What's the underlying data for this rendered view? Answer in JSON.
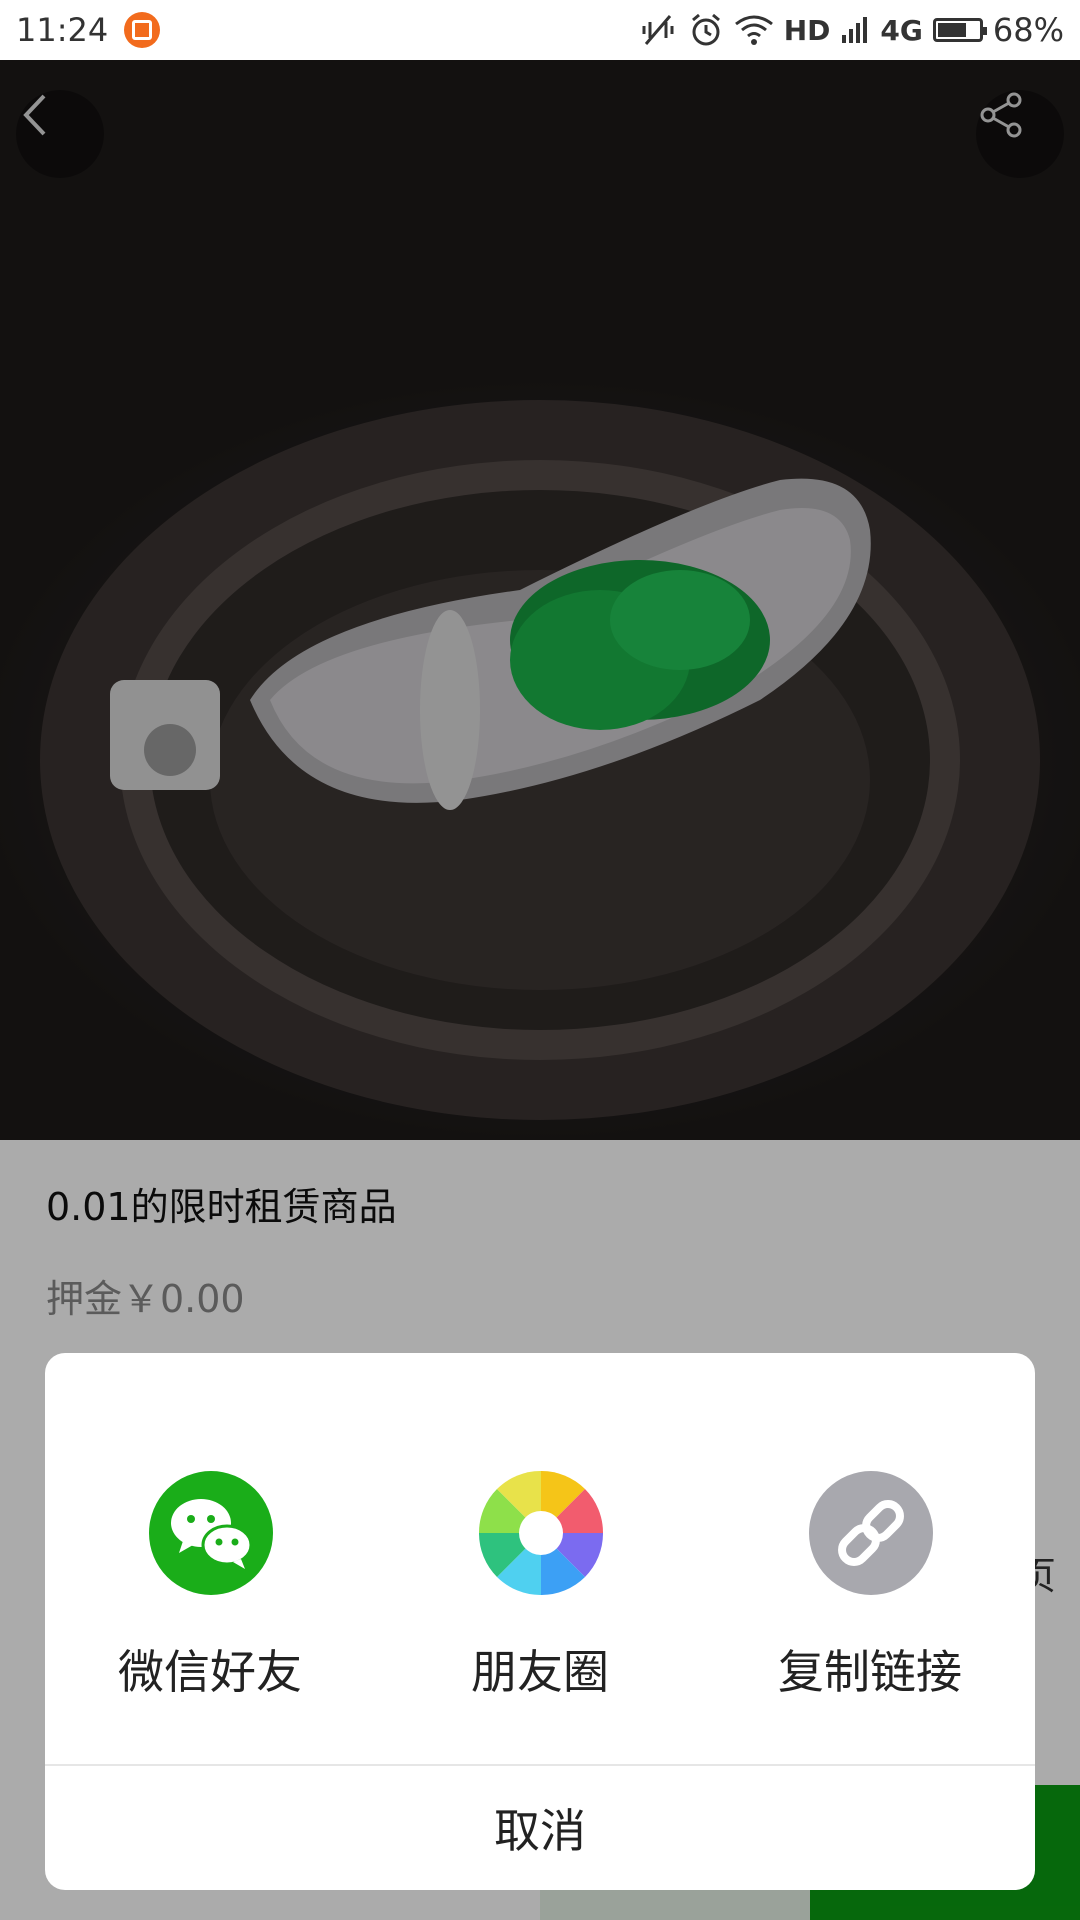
{
  "status_bar": {
    "time": "11:24",
    "network": "HD",
    "network_type": "4G",
    "battery": "68%"
  },
  "hero": {
    "back_icon": "chevron-left-icon",
    "share_icon": "share-icon"
  },
  "product": {
    "title": "0.01的限时租赁商品",
    "deposit": "押金￥0.00"
  },
  "background_partial": {
    "side_char": "页"
  },
  "share_sheet": {
    "options": [
      {
        "label": "微信好友",
        "icon": "wechat-icon",
        "color": "#1aad19"
      },
      {
        "label": "朋友圈",
        "icon": "moments-icon",
        "color": "#f6c81e"
      },
      {
        "label": "复制链接",
        "icon": "link-icon",
        "color": "#a8a8ae"
      }
    ],
    "cancel_label": "取消"
  }
}
